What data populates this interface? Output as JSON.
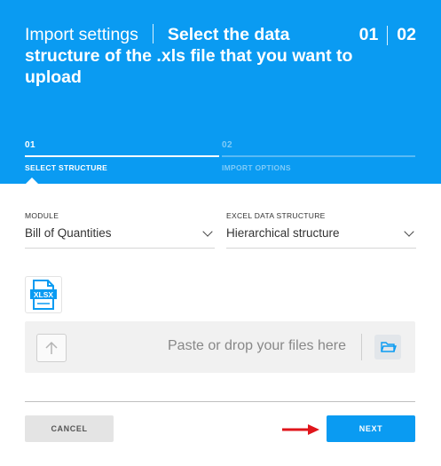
{
  "header": {
    "title_light": "Import settings",
    "title_bold": "Select the data structure of the .xls file that you want to upload",
    "counter_current": "01",
    "counter_total": "02",
    "bg_color": "#0a9bf2"
  },
  "steps": [
    {
      "number": "01",
      "label": "SELECT STRUCTURE",
      "state": "active"
    },
    {
      "number": "02",
      "label": "IMPORT OPTIONS",
      "state": "inactive"
    }
  ],
  "form": {
    "module": {
      "label": "MODULE",
      "value": "Bill of Quantities"
    },
    "structure": {
      "label": "EXCEL DATA STRUCTURE",
      "value": "Hierarchical structure"
    }
  },
  "file_icon": {
    "name": "xlsx-file-icon",
    "text": "XLSX"
  },
  "dropzone": {
    "text": "Paste or drop your files here",
    "upload_icon": "upload-arrow-icon",
    "browse_icon": "folder-icon"
  },
  "actions": {
    "cancel_label": "CANCEL",
    "next_label": "NEXT",
    "annotation_arrow_color": "#e0151b"
  }
}
